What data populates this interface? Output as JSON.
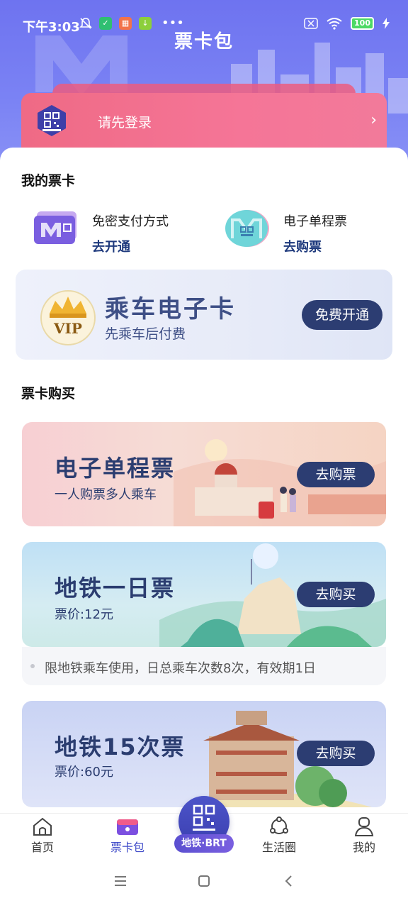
{
  "status_bar": {
    "time": "下午3:03",
    "battery": "100",
    "icons": [
      "mute-bell-icon",
      "shield-app-icon",
      "calendar-app-icon",
      "download-app-icon",
      "sim-off-icon",
      "wifi-icon",
      "charging-icon"
    ],
    "more": "•••"
  },
  "header": {
    "title": "票卡包"
  },
  "login": {
    "label": "请先登录"
  },
  "my_cards": {
    "section_title": "我的票卡",
    "items": [
      {
        "name": "免密支付方式",
        "action": "去开通",
        "icon": "payment-card-icon"
      },
      {
        "name": "电子单程票",
        "action": "去购票",
        "icon": "single-ticket-icon"
      }
    ]
  },
  "vip_card": {
    "title": "乘车电子卡",
    "subtitle": "先乘车后付费",
    "badge": "VIP",
    "button": "免费开通"
  },
  "purchase": {
    "section_title": "票卡购买",
    "cards": [
      {
        "title": "电子单程票",
        "subtitle": "一人购票多人乘车",
        "button": "去购票"
      },
      {
        "title": "地铁一日票",
        "subtitle": "票价:12元",
        "button": "去购买",
        "note": "限地铁乘车使用，日总乘车次数8次，有效期1日"
      },
      {
        "title": "地铁15次票",
        "subtitle": "票价:60元",
        "button": "去购买"
      }
    ]
  },
  "tabbar": {
    "tabs": [
      {
        "label": "首页",
        "icon": "home-icon"
      },
      {
        "label": "票卡包",
        "icon": "wallet-icon",
        "active": true
      },
      {
        "label": "地铁·BRT",
        "icon": "qr-code-icon"
      },
      {
        "label": "生活圈",
        "icon": "circle-network-icon"
      },
      {
        "label": "我的",
        "icon": "profile-icon"
      }
    ]
  },
  "colors": {
    "header": "#7177f2",
    "login_card": "#f06f8c",
    "button_dark": "#2c3d72",
    "active_tab": "#3f4bc9"
  }
}
